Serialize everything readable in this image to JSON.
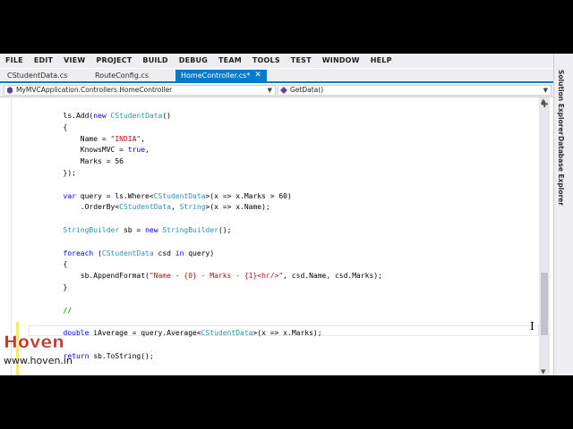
{
  "menu": [
    "FILE",
    "EDIT",
    "VIEW",
    "PROJECT",
    "BUILD",
    "DEBUG",
    "TEAM",
    "TOOLS",
    "TEST",
    "WINDOW",
    "HELP"
  ],
  "tabs": [
    {
      "label": "CStudentData.cs",
      "active": false
    },
    {
      "label": "RouteConfig.cs",
      "active": false
    },
    {
      "label": "HomeController.cs*",
      "active": true
    }
  ],
  "navbar": {
    "class_combo": "MyMVCApplication.Controllers.HomeController",
    "member_combo": "GetData()"
  },
  "side_tabs": [
    "Solution Explorer",
    "Database Explorer"
  ],
  "code_lines": [
    [
      {
        "t": "        ls.Add(",
        "c": ""
      },
      {
        "t": "new",
        "c": "kw"
      },
      {
        "t": " ",
        "c": ""
      },
      {
        "t": "CStudentData",
        "c": "ty"
      },
      {
        "t": "()",
        "c": ""
      }
    ],
    [
      {
        "t": "        {",
        "c": ""
      }
    ],
    [
      {
        "t": "            Name = ",
        "c": ""
      },
      {
        "t": "\"INDIA\"",
        "c": "st"
      },
      {
        "t": ",",
        "c": ""
      }
    ],
    [
      {
        "t": "            KnowsMVC = ",
        "c": ""
      },
      {
        "t": "true",
        "c": "kw"
      },
      {
        "t": ",",
        "c": ""
      }
    ],
    [
      {
        "t": "            Marks = 56",
        "c": ""
      }
    ],
    [
      {
        "t": "        });",
        "c": ""
      }
    ],
    [
      {
        "t": "",
        "c": ""
      }
    ],
    [
      {
        "t": "        ",
        "c": ""
      },
      {
        "t": "var",
        "c": "kw"
      },
      {
        "t": " query = ls.Where<",
        "c": ""
      },
      {
        "t": "CStudentData",
        "c": "ty"
      },
      {
        "t": ">(x => x.Marks > 60)",
        "c": ""
      }
    ],
    [
      {
        "t": "            .OrderBy<",
        "c": ""
      },
      {
        "t": "CStudentData",
        "c": "ty"
      },
      {
        "t": ", ",
        "c": ""
      },
      {
        "t": "String",
        "c": "ty"
      },
      {
        "t": ">(x => x.Name);",
        "c": ""
      }
    ],
    [
      {
        "t": "",
        "c": ""
      }
    ],
    [
      {
        "t": "        ",
        "c": ""
      },
      {
        "t": "StringBuilder",
        "c": "ty"
      },
      {
        "t": " sb = ",
        "c": ""
      },
      {
        "t": "new",
        "c": "kw"
      },
      {
        "t": " ",
        "c": ""
      },
      {
        "t": "StringBuilder",
        "c": "ty"
      },
      {
        "t": "();",
        "c": ""
      }
    ],
    [
      {
        "t": "",
        "c": ""
      }
    ],
    [
      {
        "t": "        ",
        "c": ""
      },
      {
        "t": "foreach",
        "c": "kw"
      },
      {
        "t": " (",
        "c": ""
      },
      {
        "t": "CStudentData",
        "c": "ty"
      },
      {
        "t": " csd ",
        "c": ""
      },
      {
        "t": "in",
        "c": "kw"
      },
      {
        "t": " query)",
        "c": ""
      }
    ],
    [
      {
        "t": "        {",
        "c": ""
      }
    ],
    [
      {
        "t": "            sb.AppendFormat(",
        "c": ""
      },
      {
        "t": "\"Name - {0} - Marks - {1}<hr/>\"",
        "c": "st"
      },
      {
        "t": ", csd.Name, csd.Marks);",
        "c": ""
      }
    ],
    [
      {
        "t": "        }",
        "c": ""
      }
    ],
    [
      {
        "t": "",
        "c": ""
      }
    ],
    [
      {
        "t": "        ",
        "c": ""
      },
      {
        "t": "//",
        "c": "cm"
      }
    ],
    [
      {
        "t": "",
        "c": ""
      }
    ],
    [
      {
        "t": "        ",
        "c": ""
      },
      {
        "t": "double",
        "c": "kw"
      },
      {
        "t": " iAverage = query.Average<",
        "c": ""
      },
      {
        "t": "CStudentData",
        "c": "ty"
      },
      {
        "t": ">(x => x.Marks);",
        "c": ""
      }
    ],
    [
      {
        "t": "",
        "c": ""
      }
    ],
    [
      {
        "t": "        ",
        "c": ""
      },
      {
        "t": "return",
        "c": "kw"
      },
      {
        "t": " sb.ToString();",
        "c": ""
      }
    ]
  ],
  "watermark": {
    "brand": "Hoven",
    "url": "www.hoven.in"
  }
}
